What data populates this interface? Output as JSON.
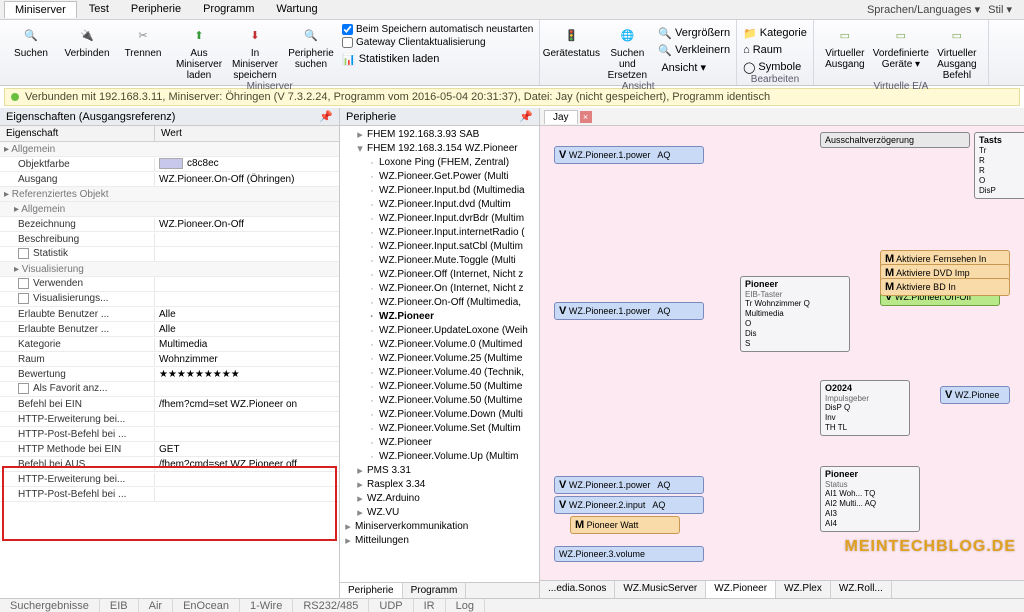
{
  "menubar": {
    "tabs": [
      "Miniserver",
      "Test",
      "Peripherie",
      "Programm",
      "Wartung"
    ],
    "active": 0,
    "lang_label": "Sprachen/Languages",
    "style_label": "Stil"
  },
  "ribbon": {
    "groups": [
      {
        "caption": "Miniserver",
        "buttons": [
          {
            "name": "suchen",
            "label": "Suchen",
            "icon": "🔍",
            "color": "#2a66c4"
          },
          {
            "name": "verbinden",
            "label": "Verbinden",
            "icon": "🔌",
            "color": "#888"
          },
          {
            "name": "trennen",
            "label": "Trennen",
            "icon": "✂",
            "color": "#888"
          },
          {
            "name": "aus-miniserver-laden",
            "label": "Aus Miniserver\nladen",
            "icon": "⬆",
            "color": "#3a9a3a"
          },
          {
            "name": "in-miniserver-speichern",
            "label": "In Miniserver\nspeichern",
            "icon": "⬇",
            "color": "#c03030"
          },
          {
            "name": "peripherie-suchen",
            "label": "Peripherie\nsuchen",
            "icon": "🔍",
            "color": "#2a66c4"
          }
        ],
        "checks": [
          {
            "label": "Beim Speichern automatisch neustarten",
            "checked": true
          },
          {
            "label": "Gateway Clientaktualisierung",
            "checked": false
          }
        ],
        "stat_btn": "Statistiken laden"
      },
      {
        "caption": "Ansicht",
        "buttons": [
          {
            "name": "geraetestatus",
            "label": "Gerätestatus",
            "icon": "🚦"
          },
          {
            "name": "suchen-ersetzen",
            "label": "Suchen und\nErsetzen",
            "icon": "🌐"
          }
        ],
        "side": [
          {
            "label": "Vergrößern",
            "icon": "🔍"
          },
          {
            "label": "Verkleinern",
            "icon": "🔍"
          },
          {
            "label": "Ansicht ▾",
            "icon": ""
          }
        ]
      },
      {
        "caption": "Bearbeiten",
        "side": [
          {
            "label": "Kategorie",
            "icon": "📁"
          },
          {
            "label": "Raum",
            "icon": "⌂"
          },
          {
            "label": "Symbole",
            "icon": "◯"
          }
        ]
      },
      {
        "caption": "Virtuelle E/A",
        "buttons": [
          {
            "name": "virt-ausgang",
            "label": "Virtueller\nAusgang",
            "icon": "▭",
            "color": "#7aa84a"
          },
          {
            "name": "vordef-geraete",
            "label": "Vordefinierte\nGeräte ▾",
            "icon": "▭",
            "color": "#7aa84a"
          },
          {
            "name": "virt-ausgang-befehl",
            "label": "Virtueller\nAusgang Befehl",
            "icon": "▭",
            "color": "#7aa84a"
          }
        ]
      }
    ]
  },
  "status_text": "Verbunden mit 192.168.3.11, Miniserver: Öhringen (V 7.3.2.24, Programm vom 2016-05-04 20:31:37), Datei: Jay (nicht gespeichert), Programm identisch",
  "props": {
    "title": "Eigenschaften (Ausgangsreferenz)",
    "col1": "Eigenschaft",
    "col2": "Wert",
    "rows": [
      {
        "type": "group",
        "label": "Allgemein"
      },
      {
        "label": "Objektfarbe",
        "value": "c8c8ec",
        "swatch": "#c8c8ec"
      },
      {
        "label": "Ausgang",
        "value": "WZ.Pioneer.On-Off (Öhringen)"
      },
      {
        "type": "group",
        "label": "Referenziertes Objekt"
      },
      {
        "type": "group",
        "label": "Allgemein",
        "indent": 1
      },
      {
        "label": "Bezeichnung",
        "value": "WZ.Pioneer.On-Off"
      },
      {
        "label": "Beschreibung",
        "value": ""
      },
      {
        "label": "Statistik",
        "checkbox": true
      },
      {
        "type": "group",
        "label": "Visualisierung",
        "indent": 1
      },
      {
        "label": "Verwenden",
        "checkbox": true
      },
      {
        "label": "Visualisierungs...",
        "checkbox": true
      },
      {
        "label": "Erlaubte Benutzer ...",
        "value": "Alle"
      },
      {
        "label": "Erlaubte Benutzer ...",
        "value": "Alle"
      },
      {
        "label": "Kategorie",
        "value": "Multimedia"
      },
      {
        "label": "Raum",
        "value": "Wohnzimmer"
      },
      {
        "label": "Bewertung",
        "value": "★★★★★★★★★"
      },
      {
        "label": "Als Favorit anz...",
        "checkbox": true
      },
      {
        "label": "Befehl bei EIN",
        "value": "/fhem?cmd=set WZ.Pioneer on",
        "hl": true
      },
      {
        "label": "HTTP-Erweiterung bei...",
        "value": "",
        "hl": true
      },
      {
        "label": "HTTP-Post-Befehl bei ...",
        "value": "",
        "hl": true
      },
      {
        "label": "HTTP Methode bei EIN",
        "value": "GET",
        "hl": true
      },
      {
        "label": "Befehl bei AUS",
        "value": "/fhem?cmd=set WZ.Pioneer off",
        "hl": true
      },
      {
        "label": "HTTP-Erweiterung bei...",
        "value": ""
      },
      {
        "label": "HTTP-Post-Befehl bei ...",
        "value": ""
      }
    ]
  },
  "tree": {
    "title": "Peripherie",
    "items": [
      {
        "d": 2,
        "exp": "▸",
        "label": "FHEM 192.168.3.93 SAB"
      },
      {
        "d": 2,
        "exp": "▾",
        "label": "FHEM 192.168.3.154 WZ.Pioneer"
      },
      {
        "d": 3,
        "exp": "·",
        "label": "Loxone Ping (FHEM, Zentral)"
      },
      {
        "d": 3,
        "exp": "·",
        "label": "WZ.Pioneer.Get.Power (Multi"
      },
      {
        "d": 3,
        "exp": "·",
        "label": "WZ.Pioneer.Input.bd (Multimedia"
      },
      {
        "d": 3,
        "exp": "·",
        "label": "WZ.Pioneer.Input.dvd (Multim"
      },
      {
        "d": 3,
        "exp": "·",
        "label": "WZ.Pioneer.Input.dvrBdr (Multim"
      },
      {
        "d": 3,
        "exp": "·",
        "label": "WZ.Pioneer.Input.internetRadio ("
      },
      {
        "d": 3,
        "exp": "·",
        "label": "WZ.Pioneer.Input.satCbl (Multim"
      },
      {
        "d": 3,
        "exp": "·",
        "label": "WZ.Pioneer.Mute.Toggle (Multi"
      },
      {
        "d": 3,
        "exp": "·",
        "label": "WZ.Pioneer.Off (Internet, Nicht z"
      },
      {
        "d": 3,
        "exp": "·",
        "label": "WZ.Pioneer.On (Internet, Nicht z"
      },
      {
        "d": 3,
        "exp": "·",
        "label": "WZ.Pioneer.On-Off (Multimedia,"
      },
      {
        "d": 3,
        "exp": "·",
        "label": "WZ.Pioneer",
        "bold": true
      },
      {
        "d": 3,
        "exp": "·",
        "label": "WZ.Pioneer.UpdateLoxone (Weih"
      },
      {
        "d": 3,
        "exp": "·",
        "label": "WZ.Pioneer.Volume.0 (Multimed"
      },
      {
        "d": 3,
        "exp": "·",
        "label": "WZ.Pioneer.Volume.25 (Multime"
      },
      {
        "d": 3,
        "exp": "·",
        "label": "WZ.Pioneer.Volume.40 (Technik,"
      },
      {
        "d": 3,
        "exp": "·",
        "label": "WZ.Pioneer.Volume.50 (Multime"
      },
      {
        "d": 3,
        "exp": "·",
        "label": "WZ.Pioneer.Volume.50 (Multime"
      },
      {
        "d": 3,
        "exp": "·",
        "label": "WZ.Pioneer.Volume.Down (Multi"
      },
      {
        "d": 3,
        "exp": "·",
        "label": "WZ.Pioneer.Volume.Set (Multim"
      },
      {
        "d": 3,
        "exp": "·",
        "label": "WZ.Pioneer"
      },
      {
        "d": 3,
        "exp": "·",
        "label": "WZ.Pioneer.Volume.Up (Multim"
      },
      {
        "d": 2,
        "exp": "▸",
        "label": "PMS 3.31"
      },
      {
        "d": 2,
        "exp": "▸",
        "label": "Rasplex 3.34"
      },
      {
        "d": 2,
        "exp": "▸",
        "label": "WZ.Arduino"
      },
      {
        "d": 2,
        "exp": "▸",
        "label": "WZ.VU"
      },
      {
        "d": 1,
        "exp": "▸",
        "label": "Miniserverkommunikation"
      },
      {
        "d": 1,
        "exp": "▸",
        "label": "Mitteilungen"
      }
    ],
    "tabs": [
      "Peripherie",
      "Programm"
    ],
    "active_tab": 0
  },
  "canvas": {
    "tab": "Jay",
    "bottom_tabs": [
      "...edia.Sonos",
      "WZ.MusicServer",
      "WZ.Pioneer",
      "WZ.Plex",
      "WZ.Roll..."
    ],
    "nodes": {
      "n1": {
        "label": "WZ.Pioneer.1.power",
        "prefix": "V",
        "aq": "AQ"
      },
      "n2": {
        "label": "WZ.Pioneer.1.power",
        "prefix": "V",
        "aq": "AQ"
      },
      "n3": {
        "label": "WZ.Pioneer.1.power",
        "prefix": "V",
        "aq": "AQ"
      },
      "n4": {
        "label": "WZ.Pioneer.2.input",
        "prefix": "V",
        "aq": "AQ"
      },
      "n5": {
        "label": "Pioneer Watt",
        "prefix": "M"
      },
      "n6": {
        "label": "WZ.Pioneer.3.volume"
      },
      "top": {
        "label": "Ausschaltverzögerung"
      },
      "eib": {
        "title": "Pioneer",
        "sub": "EIB-Taster",
        "rows": [
          "Tr Wohnzimmer Q",
          "Multimedia",
          "O",
          "Dis",
          "S"
        ]
      },
      "onoff": {
        "label": "WZ.Pioneer.On-Off",
        "prefix": "V"
      },
      "act": [
        {
          "p": "M",
          "label": "Aktiviere Fernsehen In"
        },
        {
          "p": "M",
          "label": "Aktiviere DVD Imp"
        },
        {
          "p": "M",
          "label": "Aktiviere BD In"
        }
      ],
      "imp": {
        "title": "O2024",
        "sub": "Impulsgeber",
        "rows": [
          "DisP   Q",
          "Inv",
          "TH TL"
        ]
      },
      "stat": {
        "title": "Pioneer",
        "sub": "Status",
        "rows": [
          "AI1 Woh...  TQ",
          "AI2 Multi...  AQ",
          "AI3",
          "AI4"
        ]
      },
      "wzpio": {
        "label": "WZ.Pionee",
        "prefix": "V"
      },
      "side": {
        "label": "Tasts",
        "rows": [
          "Tr",
          "R",
          "R",
          "O",
          "DisP"
        ]
      }
    }
  },
  "footer": [
    "Suchergebnisse",
    "EIB",
    "Air",
    "EnOcean",
    "1-Wire",
    "RS232/485",
    "UDP",
    "IR",
    "Log"
  ],
  "watermark": "MEINTECHBLOG.DE"
}
